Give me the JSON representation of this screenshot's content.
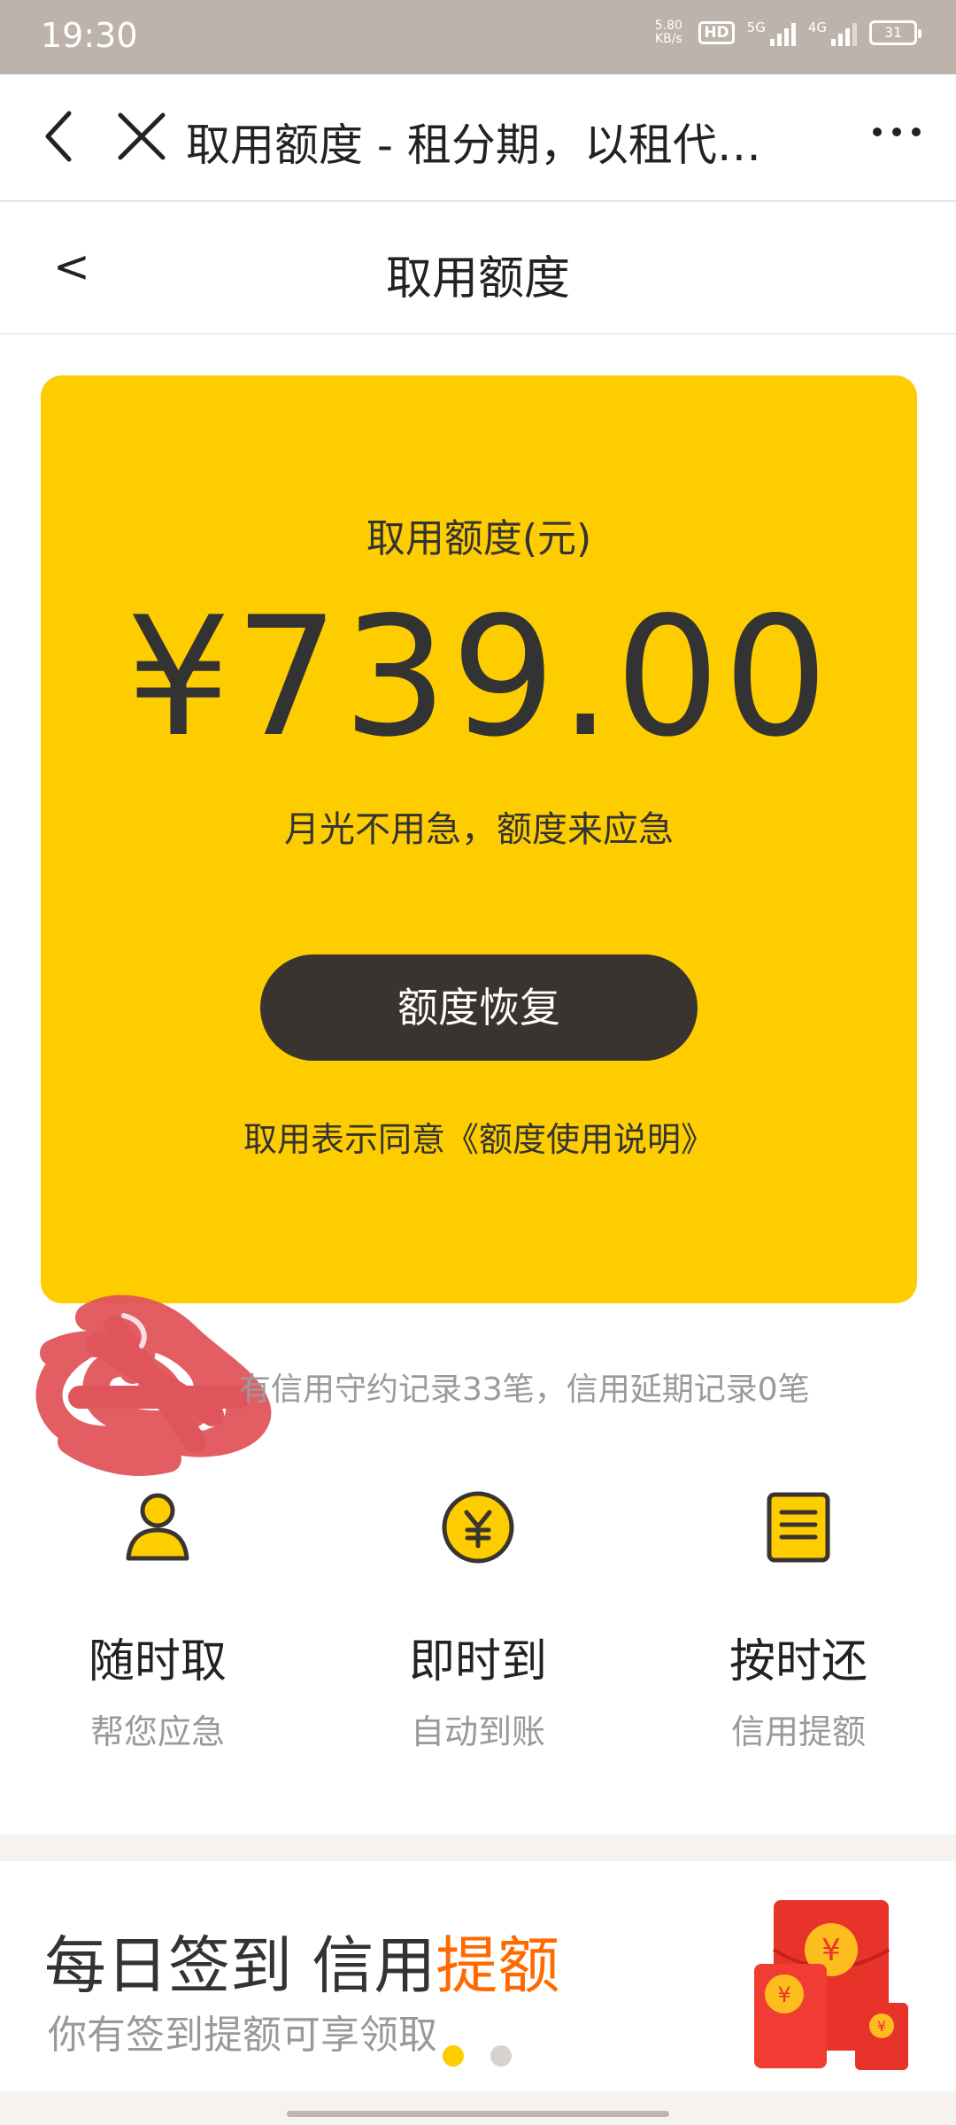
{
  "status_bar": {
    "time": "19:30",
    "net_speed_value": "5.80",
    "net_speed_unit": "KB/s",
    "hd_label": "HD",
    "sim1_label": "5G",
    "sim2_label": "4G",
    "battery": "31"
  },
  "title_bar": {
    "title": "取用额度 - 租分期，以租代…"
  },
  "page_header": {
    "title": "取用额度",
    "back_glyph": "<"
  },
  "card": {
    "label": "取用额度(元)",
    "amount": "¥739.00",
    "slogan": "月光不用急，额度来应急",
    "button_label": "额度恢复",
    "agreement": "取用表示同意《额度使用说明》",
    "background_color": "#fecd00"
  },
  "credit_record": "有信用守约记录33笔，信用延期记录0笔",
  "features": [
    {
      "title": "随时取",
      "subtitle": "帮您应急",
      "icon": "person-icon"
    },
    {
      "title": "即时到",
      "subtitle": "自动到账",
      "icon": "yen-coin-icon"
    },
    {
      "title": "按时还",
      "subtitle": "信用提额",
      "icon": "document-icon"
    }
  ],
  "banner": {
    "title_prefix": "每日签到 信用",
    "title_highlight": "提额",
    "subtitle": "你有签到提额可享领取",
    "highlight_color": "#ff6a00",
    "carousel_active_index": 0,
    "carousel_count": 2
  }
}
